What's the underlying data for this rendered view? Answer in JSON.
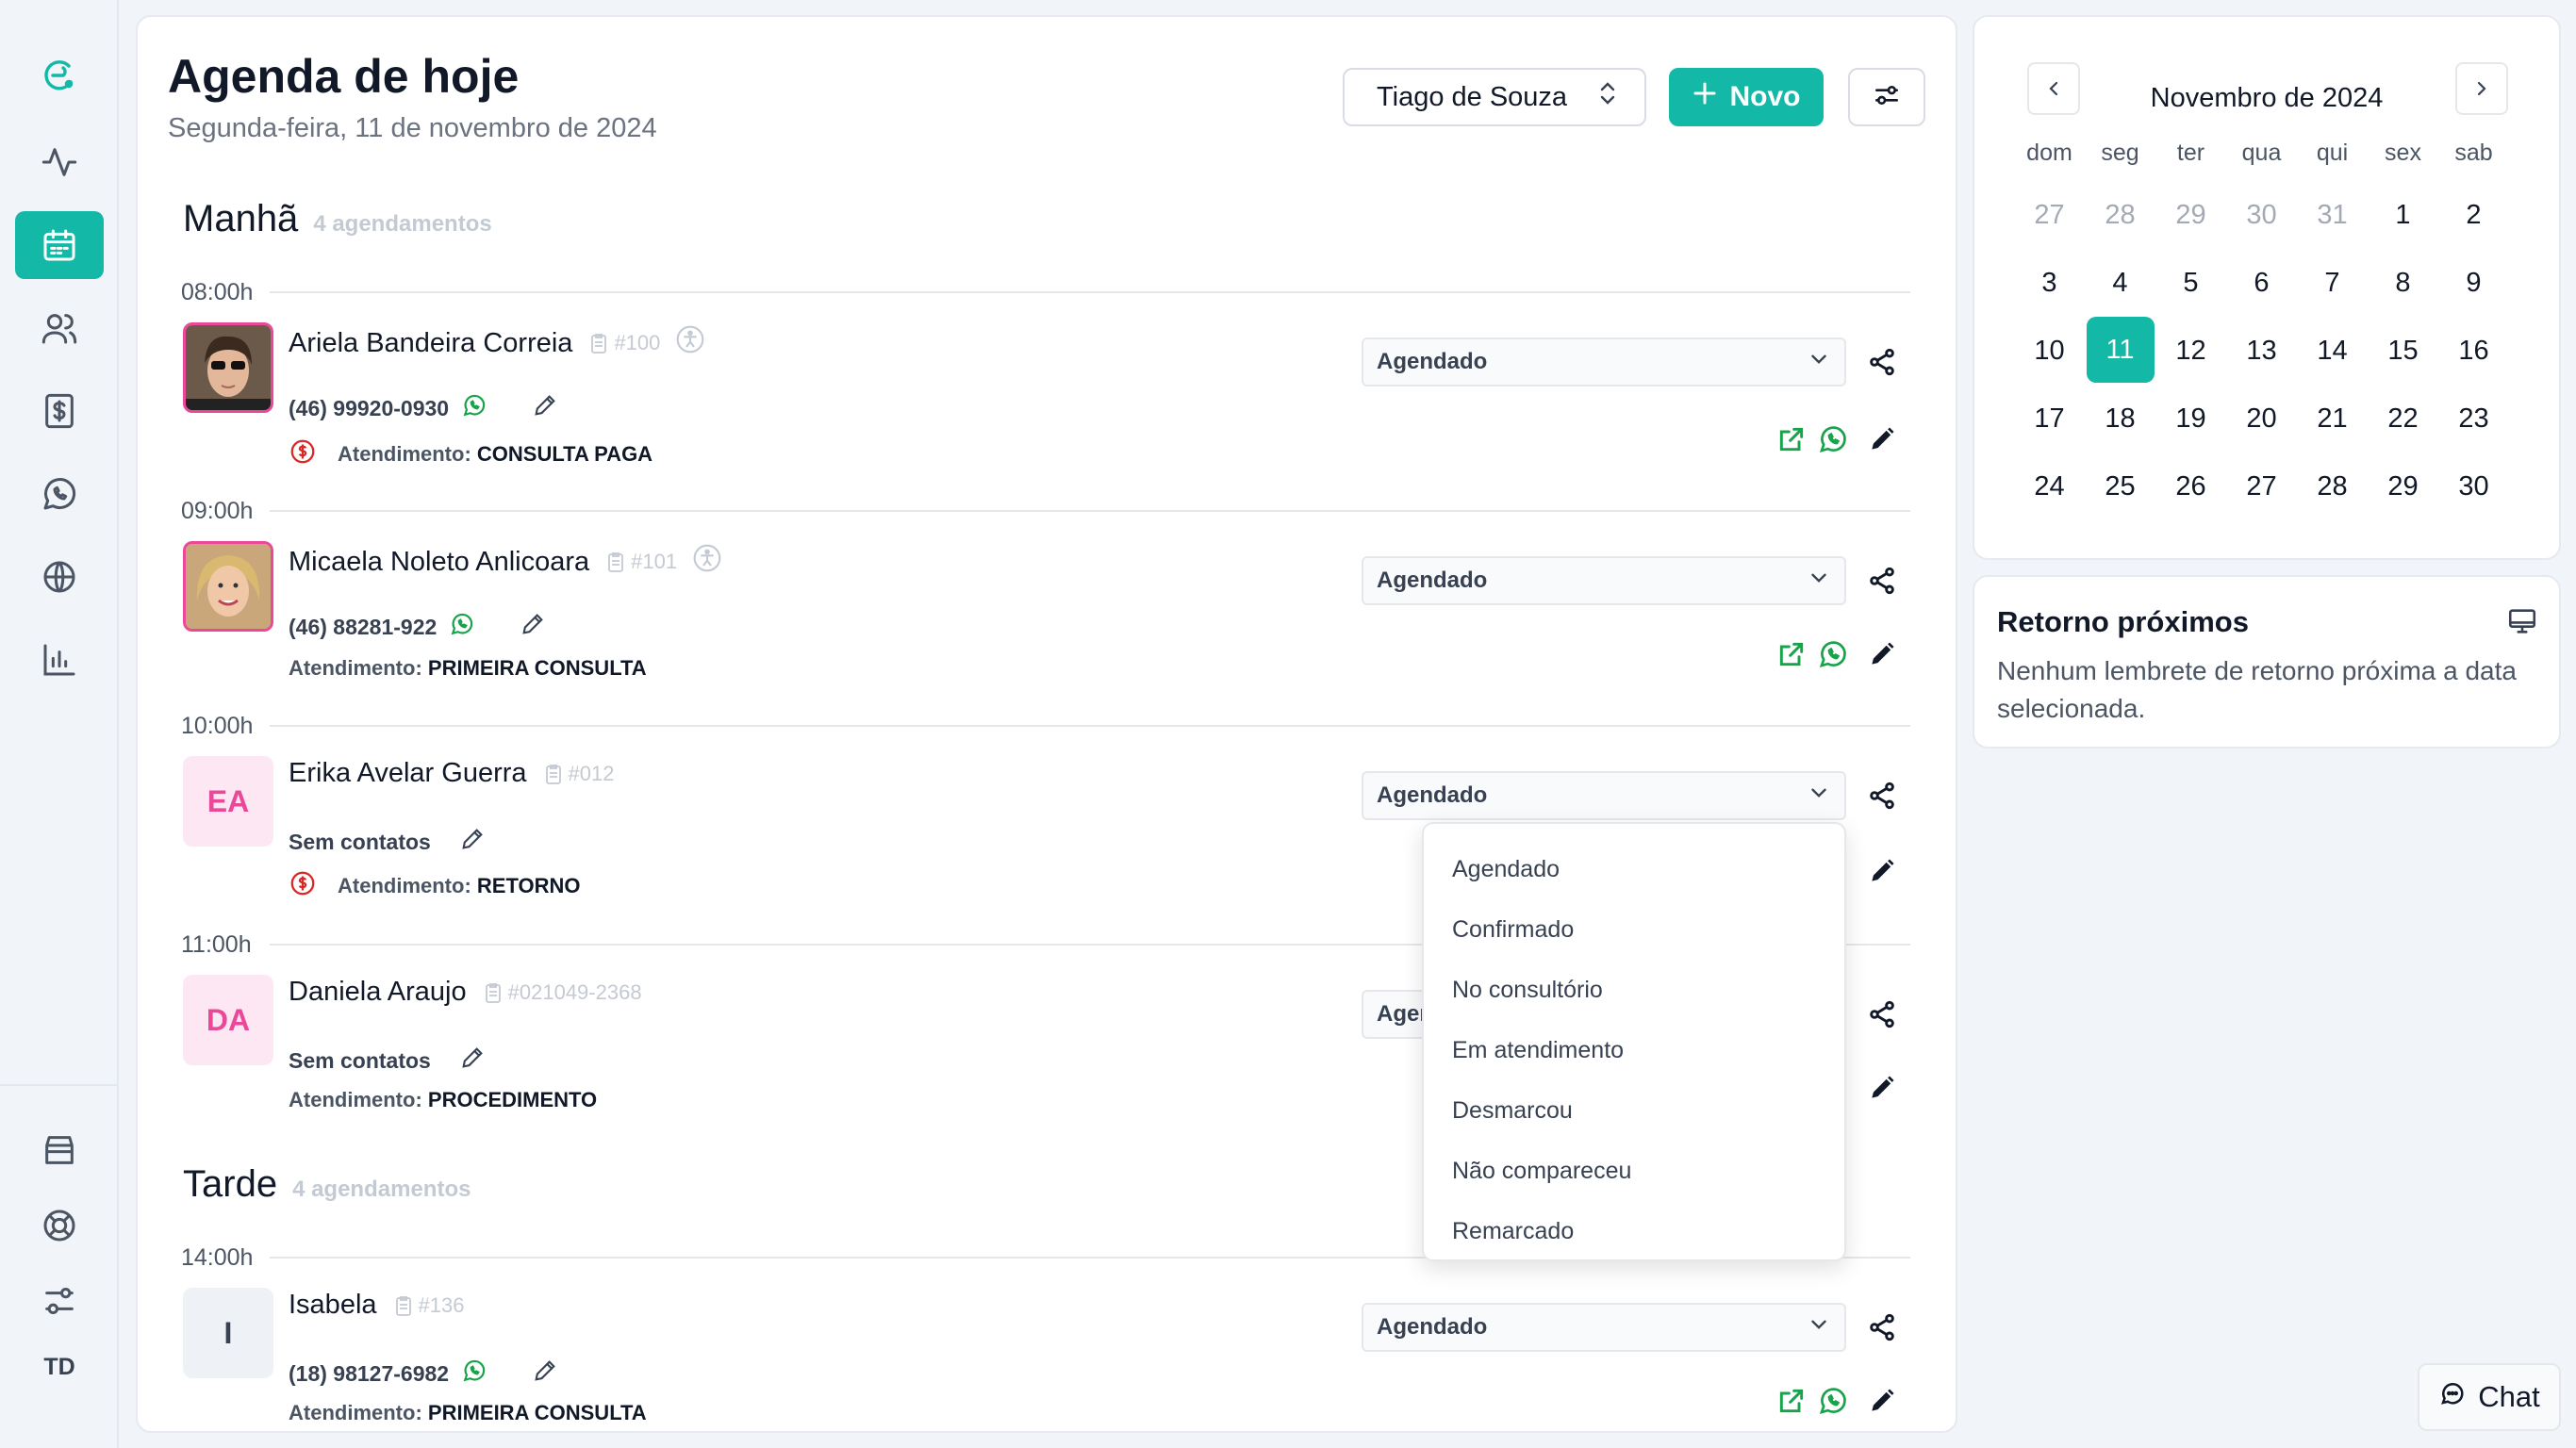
{
  "page": {
    "title": "Agenda de hoje",
    "subtitle": "Segunda-feira, 11 de novembro de 2024",
    "doctor": "Tiago de Souza",
    "new_button": "Novo"
  },
  "sidebar": {
    "items": [
      {
        "icon": "logo-icon"
      },
      {
        "icon": "activity-icon"
      },
      {
        "icon": "calendar-icon",
        "active": true
      },
      {
        "icon": "users-icon"
      },
      {
        "icon": "billing-icon"
      },
      {
        "icon": "whatsapp-icon"
      },
      {
        "icon": "globe-icon"
      },
      {
        "icon": "bar-chart-icon"
      }
    ],
    "bottom": [
      {
        "icon": "store-icon"
      },
      {
        "icon": "lifebuoy-icon"
      },
      {
        "icon": "settings-sliders-icon"
      }
    ],
    "initials": "TD"
  },
  "sections": [
    {
      "title": "Manhã",
      "count": "4 agendamentos"
    },
    {
      "title": "Tarde",
      "count": "4 agendamentos"
    }
  ],
  "appointments": [
    {
      "time": "08:00h",
      "name": "Ariela Bandeira Correia",
      "id": "#100",
      "phone": "(46) 99920-0930",
      "atend_label": "Atendimento:",
      "atend_value": "CONSULTA PAGA",
      "status": "Agendado",
      "paid_icon": true
    },
    {
      "time": "09:00h",
      "name": "Micaela Noleto Anlicoara",
      "id": "#101",
      "phone": "(46) 88281-922",
      "atend_label": "Atendimento:",
      "atend_value": "PRIMEIRA CONSULTA",
      "status": "Agendado"
    },
    {
      "time": "10:00h",
      "name": "Erika Avelar Guerra",
      "id": "#012",
      "initials": "EA",
      "phone": "Sem contatos",
      "atend_label": "Atendimento:",
      "atend_value": "RETORNO",
      "status": "Agendado",
      "paid_icon": true
    },
    {
      "time": "11:00h",
      "name": "Daniela Araujo",
      "id": "#021049-2368",
      "initials": "DA",
      "phone": "Sem contatos",
      "atend_label": "Atendimento:",
      "atend_value": "PROCEDIMENTO",
      "status": "Ager"
    },
    {
      "time": "14:00h",
      "name": "Isabela",
      "id": "#136",
      "initials": "I",
      "phone": "(18) 98127-6982",
      "atend_label": "Atendimento:",
      "atend_value": "PRIMEIRA CONSULTA",
      "status": "Agendado"
    }
  ],
  "status_options": [
    "Agendado",
    "Confirmado",
    "No consultório",
    "Em atendimento",
    "Desmarcou",
    "Não compareceu",
    "Remarcado"
  ],
  "calendar": {
    "title": "Novembro de 2024",
    "weekdays": [
      "dom",
      "seg",
      "ter",
      "qua",
      "qui",
      "sex",
      "sab"
    ],
    "weeks": [
      [
        "27",
        "28",
        "29",
        "30",
        "31",
        "1",
        "2"
      ],
      [
        "3",
        "4",
        "5",
        "6",
        "7",
        "8",
        "9"
      ],
      [
        "10",
        "11",
        "12",
        "13",
        "14",
        "15",
        "16"
      ],
      [
        "17",
        "18",
        "19",
        "20",
        "21",
        "22",
        "23"
      ],
      [
        "24",
        "25",
        "26",
        "27",
        "28",
        "29",
        "30"
      ]
    ],
    "selected": "11"
  },
  "retorno": {
    "title": "Retorno próximos",
    "text": "Nenhum lembrete de retorno próxima a data selecionada."
  },
  "chat": {
    "label": "Chat"
  },
  "colors": {
    "accent": "#14b8a6",
    "pink": "#ec4899",
    "whatsapp": "#16a34a",
    "paid": "#dc2626"
  }
}
